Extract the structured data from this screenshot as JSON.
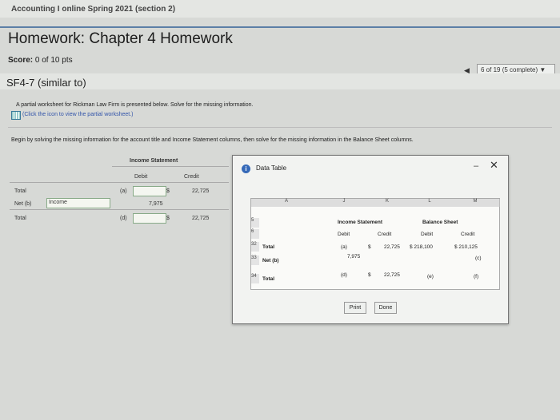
{
  "header": {
    "course": "Accounting I online Spring 2021 (section 2)",
    "title": "Homework: Chapter 4 Homework"
  },
  "score": {
    "label": "Score:",
    "value": "0 of 10 pts"
  },
  "progress": {
    "text": "6 of 19 (5 complete)"
  },
  "question": {
    "id": "SF4-7 (similar to)",
    "prompt": "A partial worksheet for Rickman Law Firm is presented below. Solve for the missing information.",
    "link": "(Click the icon to view the partial worksheet.)",
    "instruction": "Begin by solving the missing information for the account title and Income Statement columns, then solve for the missing information in the Balance Sheet columns."
  },
  "worksheet": {
    "group_header": "Income Statement",
    "debit": "Debit",
    "credit": "Credit",
    "rows": [
      {
        "label": "Total",
        "debit": "(a)",
        "sym": "$",
        "credit": "22,725"
      },
      {
        "label": "Net (b)",
        "field": "Income",
        "debit": "7,975",
        "credit": ""
      },
      {
        "label": "Total",
        "debit": "(d)",
        "sym": "$",
        "credit": "22,725"
      }
    ]
  },
  "modal": {
    "title": "Data Table",
    "cols": [
      "A",
      "J",
      "K",
      "L",
      "M"
    ],
    "row5": {
      "num": "5",
      "income_statement": "Income Statement",
      "balance_sheet": "Balance Sheet"
    },
    "row6": {
      "num": "6",
      "debit1": "Debit",
      "credit1": "Credit",
      "debit2": "Debit",
      "credit2": "Credit"
    },
    "rows": [
      {
        "num": "32",
        "label": "Total",
        "j": "(a)",
        "sym": "$",
        "k": "22,725",
        "l": "$ 218,100",
        "m": "$ 210,125"
      },
      {
        "num": "33",
        "label": "Net (b)",
        "j": "7,975",
        "k": "",
        "l": "",
        "m": "(c)"
      },
      {
        "num": "34",
        "label": "Total",
        "j": "(d)",
        "sym": "$",
        "k": "22,725",
        "l": "(e)",
        "m": "(f)"
      }
    ],
    "print": "Print",
    "done": "Done"
  }
}
